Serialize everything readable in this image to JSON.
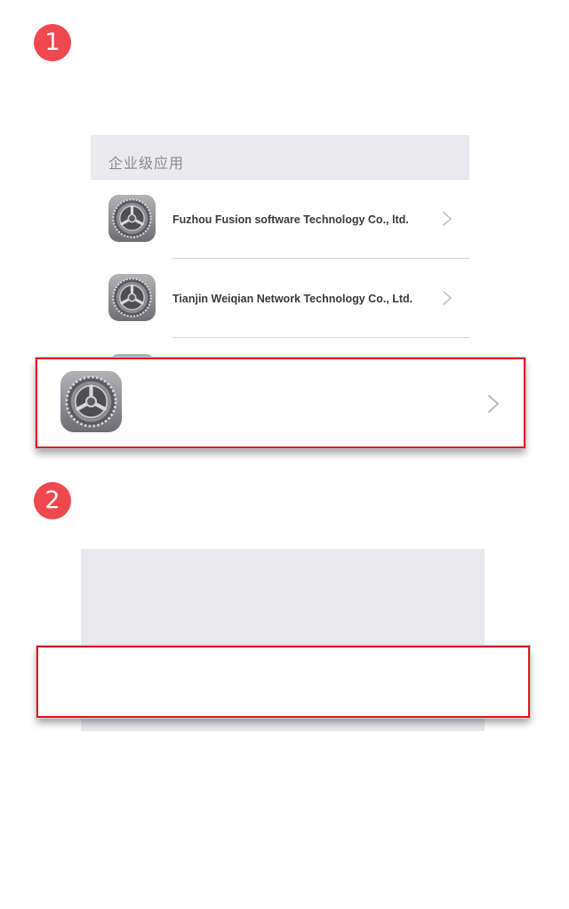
{
  "steps": [
    "1",
    "2"
  ],
  "panel1": {
    "section_header": "企业级应用",
    "rows": [
      {
        "label": "Fuzhou Fusion software Technology Co., ltd.",
        "icon": "settings-gear-icon"
      },
      {
        "label": "Tianjin Weiqian Network Technology Co., Ltd.",
        "icon": "settings-gear-icon"
      }
    ]
  },
  "callout1": {
    "icon": "settings-gear-icon",
    "accessory": "chevron-right-icon"
  },
  "colors": {
    "badge": "#f0484f",
    "highlight_border": "#e0141e",
    "section_header_bg": "#e9e9ee"
  }
}
